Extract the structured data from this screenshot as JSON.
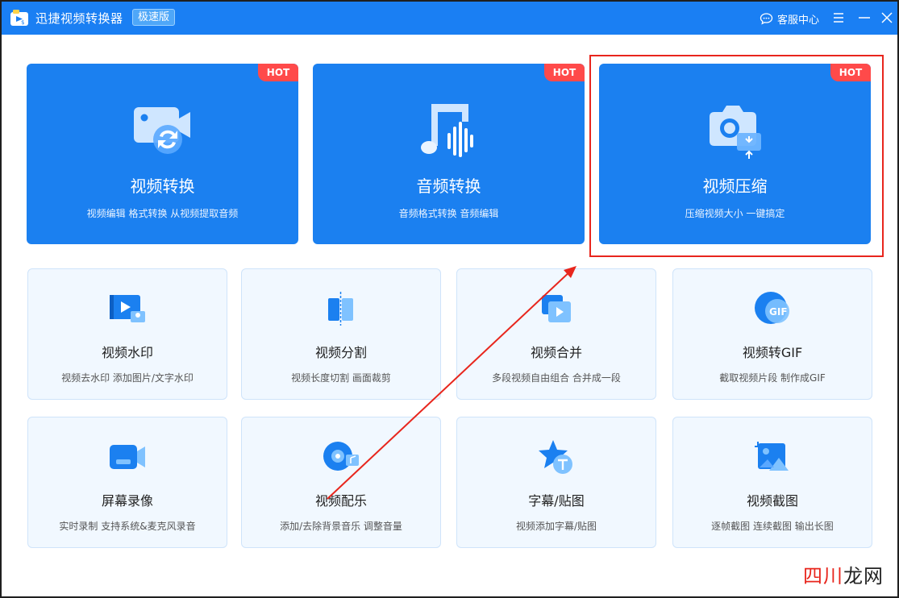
{
  "titlebar": {
    "app_name": "迅捷视频转换器",
    "edition": "极速版",
    "support_label": "客服中心"
  },
  "big_cards": [
    {
      "title": "视频转换",
      "subtitle": "视频编辑 格式转换 从视频提取音频",
      "badge": "HOT",
      "icon": "video-convert-icon"
    },
    {
      "title": "音频转换",
      "subtitle": "音频格式转换 音频编辑",
      "badge": "HOT",
      "icon": "music-note-icon"
    },
    {
      "title": "视频压缩",
      "subtitle": "压缩视频大小 一键搞定",
      "badge": "HOT",
      "icon": "camera-compress-icon"
    }
  ],
  "small_cards": [
    {
      "title": "视频水印",
      "subtitle": "视频去水印 添加图片/文字水印",
      "icon": "video-watermark-icon"
    },
    {
      "title": "视频分割",
      "subtitle": "视频长度切割 画面裁剪",
      "icon": "video-split-icon"
    },
    {
      "title": "视频合并",
      "subtitle": "多段视频自由组合 合并成一段",
      "icon": "video-merge-icon"
    },
    {
      "title": "视频转GIF",
      "subtitle": "截取视频片段 制作成GIF",
      "icon": "gif-icon"
    },
    {
      "title": "屏幕录像",
      "subtitle": "实时录制 支持系统&麦克风录音",
      "icon": "screen-record-icon"
    },
    {
      "title": "视频配乐",
      "subtitle": "添加/去除背景音乐 调整音量",
      "icon": "music-disc-icon"
    },
    {
      "title": "字幕/贴图",
      "subtitle": "视频添加字幕/贴图",
      "icon": "star-text-icon"
    },
    {
      "title": "视频截图",
      "subtitle": "逐帧截图 连续截图 输出长图",
      "icon": "screenshot-crop-icon"
    }
  ],
  "colors": {
    "titlebar": "#1a7ff3",
    "big_card": "#1b80f0",
    "hot_badge": "#ff4a4a",
    "small_card": "#f1f8ff",
    "annotation": "#e8261d"
  },
  "watermark": {
    "part_a": "四川",
    "part_b": "龙网"
  }
}
